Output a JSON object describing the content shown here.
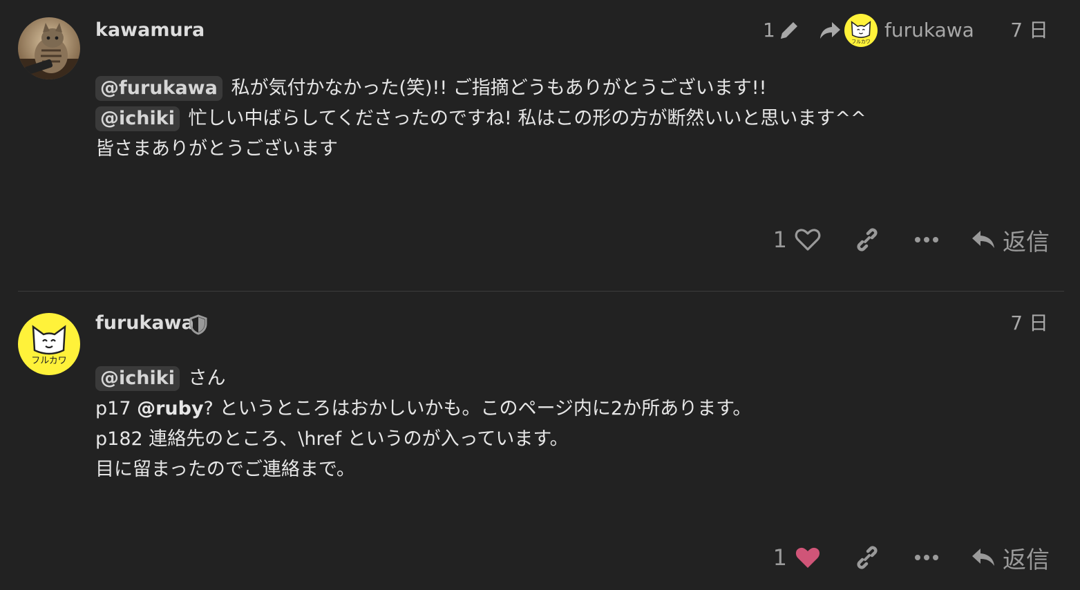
{
  "posts": [
    {
      "username": "kawamura",
      "edit_count": "1",
      "reply_to": "furukawa",
      "date": "7 日",
      "lines": {
        "l1_mention": "@furukawa",
        "l1_text": "私が気付かなかった(笑)!! ご指摘どうもありがとうございます!!",
        "l2_mention": "@ichiki",
        "l2_text": "忙しい中ばらしてくださったのですね! 私はこの形の方が断然いいと思います^^",
        "l3_text": "皆さまありがとうございます"
      },
      "likes": "1",
      "liked": false,
      "reply_label": "返信"
    },
    {
      "username": "furukawa",
      "date": "7 日",
      "lines": {
        "l1_mention": "@ichiki",
        "l1_text": "さん",
        "l2_prefix": "p17 ",
        "l2_bold": "@ruby",
        "l2_text": "? というところはおかしいかも。このページ内に2か所あります。",
        "l3_text": "p182 連絡先のところ、\\href というのが入っています。",
        "l4_text": "目に留まったのでご連絡まで。"
      },
      "likes": "1",
      "liked": true,
      "reply_label": "返信"
    }
  ],
  "avatar_caption": "フルカワ",
  "colors": {
    "background": "#222222",
    "heart_liked": "#d05578",
    "avatar_yellow": "#fff23a"
  }
}
